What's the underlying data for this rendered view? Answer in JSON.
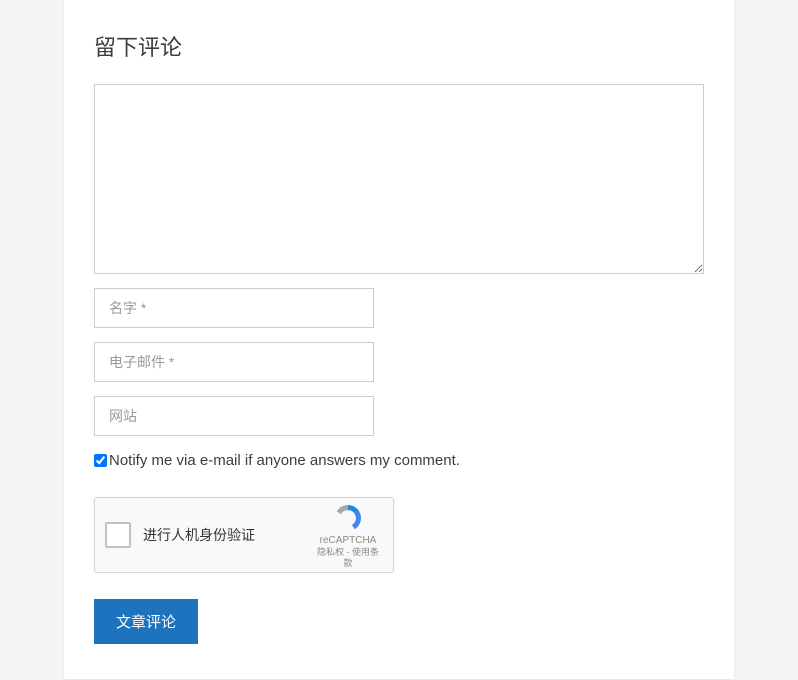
{
  "heading": "留下评论",
  "comment_value": "",
  "name_placeholder": "名字 *",
  "email_placeholder": "电子邮件 *",
  "website_placeholder": "网站",
  "notify_label": "Notify me via e-mail if anyone answers my comment.",
  "notify_checked": true,
  "recaptcha": {
    "label": "进行人机身份验证",
    "brand": "reCAPTCHA",
    "terms": "隐私权 - 使用条款"
  },
  "submit_label": "文章评论"
}
